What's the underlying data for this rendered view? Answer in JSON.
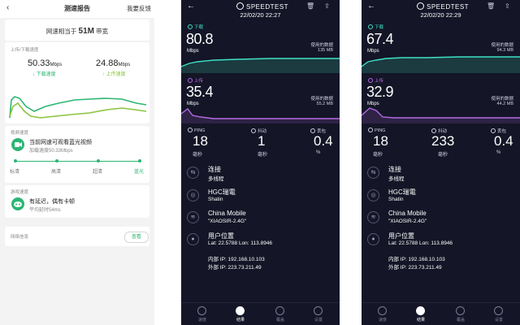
{
  "report": {
    "title": "测速报告",
    "feedback": "我要反馈",
    "bandwidth_prefix": "网速相当于",
    "bandwidth_value": "51M",
    "bandwidth_suffix": "带宽",
    "speed_section": "上传/下载速度",
    "download_value": "50.33",
    "download_unit": "Mbps",
    "download_label": "下载速度",
    "upload_value": "24.88",
    "upload_unit": "Mbps",
    "upload_label": "上传速度",
    "video_section": "视频速度",
    "video_line1": "当前网速可观看蓝光视频",
    "video_line2": "加载速度50.33Mbps",
    "video_stages": [
      "标清",
      "高清",
      "超清",
      "蓝光"
    ],
    "game_section": "游戏速度",
    "game_line1": "有延迟，偶有卡顿",
    "game_line2": "平均延时54ms",
    "network_info": "网络信息",
    "view_button": "查看",
    "colors": {
      "accent": "#2bb673",
      "download_line": "#2bb673",
      "upload_line": "#8ac43f"
    }
  },
  "results": [
    {
      "brand": "SPEEDTEST",
      "date": "22/02/20 22:27",
      "download_label": "下载",
      "download_value": "80.8",
      "download_unit": "Mbps",
      "download_used_label": "使用的数据",
      "download_used": "135 MB",
      "upload_label": "上传",
      "upload_value": "35.4",
      "upload_unit": "Mbps",
      "upload_used_label": "使用的数据",
      "upload_used": "55.2 MB",
      "ping_label": "PING",
      "ping_value": "18",
      "ping_unit": "毫秒",
      "jitter_label": "抖动",
      "jitter_value": "1",
      "jitter_unit": "毫秒",
      "loss_label": "丢包",
      "loss_value": "0.4",
      "loss_unit": "%",
      "connection_title": "连接",
      "connection_value": "多线程",
      "provider_title": "HGC瑞電",
      "provider_value": "Shatin",
      "carrier_title": "China Mobile",
      "carrier_value": "\"XIAOSIR-2.4G\"",
      "location_title": "用户位置",
      "location_value": "Lat: 22.5788 Lon: 113.8946",
      "internal_ip": "内部 IP: 192.168.10.103",
      "external_ip": "外部 IP: 223.73.211.49",
      "nav": [
        "速度",
        "结果",
        "覆盖",
        "设置"
      ]
    },
    {
      "brand": "SPEEDTEST",
      "date": "22/02/20 22:29",
      "download_label": "下载",
      "download_value": "67.4",
      "download_unit": "Mbps",
      "download_used_label": "使用的数据",
      "download_used": "94.3 MB",
      "upload_label": "上传",
      "upload_value": "32.9",
      "upload_unit": "Mbps",
      "upload_used_label": "使用的数据",
      "upload_used": "44.2 MB",
      "ping_label": "PING",
      "ping_value": "18",
      "ping_unit": "毫秒",
      "jitter_label": "抖动",
      "jitter_value": "233",
      "jitter_unit": "毫秒",
      "loss_label": "丢包",
      "loss_value": "0.4",
      "loss_unit": "%",
      "connection_title": "连接",
      "connection_value": "多线程",
      "provider_title": "HGC瑞電",
      "provider_value": "Shatin",
      "carrier_title": "China Mobile",
      "carrier_value": "\"XIAOSIR-2.4G\"",
      "location_title": "用户位置",
      "location_value": "Lat: 22.5788 Lon: 113.8946",
      "internal_ip": "内部 IP: 192.168.10.103",
      "external_ip": "外部 IP: 223.73.211.49",
      "nav": [
        "速度",
        "结果",
        "覆盖",
        "设置"
      ]
    }
  ],
  "colors": {
    "dark_bg": "#141526",
    "download_accent": "#3fe0c5",
    "upload_accent": "#b36be3"
  }
}
